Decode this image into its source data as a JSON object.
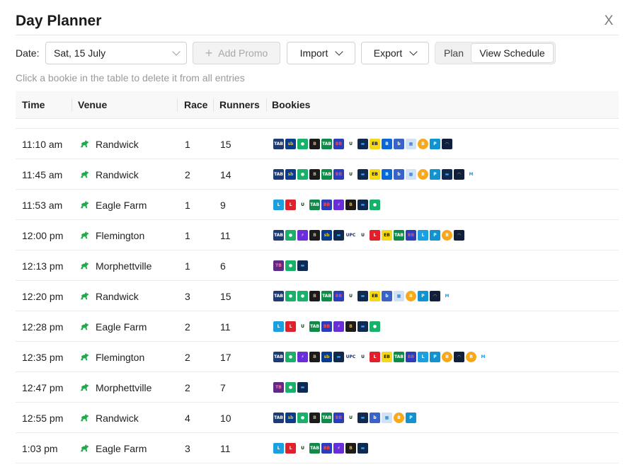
{
  "header": {
    "title": "Day Planner",
    "close_label": "X"
  },
  "toolbar": {
    "date_label": "Date:",
    "date_value": "Sat, 15 July",
    "add_promo_label": "Add Promo",
    "import_label": "Import",
    "export_label": "Export",
    "plan_label": "Plan",
    "view_schedule_label": "View Schedule"
  },
  "hint": "Click a bookie in the table to delete it from all entries",
  "table": {
    "columns": [
      "Time",
      "Venue",
      "Race",
      "Runners",
      "Bookies"
    ],
    "rows": [
      {
        "time": "11:10 am",
        "venue": "Randwick",
        "race": "1",
        "runners": "15",
        "bookies": [
          "tab",
          "sportsbet",
          "pointsbet-green",
          "betdeluxe",
          "tab-green",
          "betr-bb",
          "unibet",
          "bluebet",
          "elitebet",
          "betright-b",
          "bossbet-b",
          "bet-box",
          "bitcoin-b",
          "palmerbet-p",
          "wifi-bet"
        ]
      },
      {
        "time": "11:45 am",
        "venue": "Randwick",
        "race": "2",
        "runners": "14",
        "bookies": [
          "tab",
          "sportsbet",
          "pointsbet-green",
          "betdeluxe",
          "tab-green",
          "betr-bb",
          "unibet",
          "bluebet",
          "elitebet",
          "betright-b",
          "bossbet-b",
          "bet-box",
          "bitcoin-b",
          "palmerbet-p",
          "bluebet",
          "wifi-bet",
          "m-bet"
        ]
      },
      {
        "time": "11:53 am",
        "venue": "Eagle Farm",
        "race": "1",
        "runners": "9",
        "bookies": [
          "ladbrokes-blue",
          "ladbrokes-red",
          "unibet",
          "tab-green",
          "betr-bb",
          "betflux",
          "betdeluxe",
          "bluebet",
          "pointsbet-green"
        ]
      },
      {
        "time": "12:00 pm",
        "venue": "Flemington",
        "race": "1",
        "runners": "11",
        "bookies": [
          "tab",
          "pointsbet-green",
          "betflux",
          "betdeluxe",
          "sportsbet",
          "bluebet",
          "upc",
          "unibet",
          "ladbrokes-red",
          "elitebet",
          "tab-green",
          "betr-bb",
          "ladbrokes-blue",
          "palmerbet-p",
          "bitcoin-b",
          "wifi-bet"
        ]
      },
      {
        "time": "12:13 pm",
        "venue": "Morphettville",
        "race": "1",
        "runners": "6",
        "bookies": [
          "tab-purple",
          "pointsbet-green",
          "bluebet"
        ]
      },
      {
        "time": "12:20 pm",
        "venue": "Randwick",
        "race": "3",
        "runners": "15",
        "bookies": [
          "tab",
          "pointsbet-green",
          "pointsbet-green",
          "betdeluxe",
          "tab-green",
          "betr-bb",
          "unibet",
          "bluebet",
          "elitebet",
          "bossbet-b",
          "bet-box",
          "bitcoin-b",
          "palmerbet-p",
          "wifi-bet",
          "m-bet"
        ]
      },
      {
        "time": "12:28 pm",
        "venue": "Eagle Farm",
        "race": "2",
        "runners": "11",
        "bookies": [
          "ladbrokes-blue",
          "ladbrokes-red",
          "unibet",
          "tab-green",
          "betr-bb",
          "betflux",
          "betdeluxe",
          "bluebet",
          "pointsbet-green"
        ]
      },
      {
        "time": "12:35 pm",
        "venue": "Flemington",
        "race": "2",
        "runners": "17",
        "bookies": [
          "tab",
          "pointsbet-green",
          "betflux",
          "betdeluxe",
          "sportsbet",
          "bluebet",
          "upc",
          "unibet",
          "ladbrokes-red",
          "elitebet",
          "tab-green",
          "betr-bb",
          "ladbrokes-blue",
          "palmerbet-p",
          "bitcoin-b",
          "wifi-bet",
          "bitcoin-b",
          "m-bet"
        ]
      },
      {
        "time": "12:47 pm",
        "venue": "Morphettville",
        "race": "2",
        "runners": "7",
        "bookies": [
          "tab-purple",
          "pointsbet-green",
          "bluebet"
        ]
      },
      {
        "time": "12:55 pm",
        "venue": "Randwick",
        "race": "4",
        "runners": "10",
        "bookies": [
          "tab",
          "sportsbet",
          "pointsbet-green",
          "betdeluxe",
          "tab-green",
          "betr-bb",
          "unibet",
          "bluebet",
          "bossbet-b",
          "bet-box",
          "bitcoin-b",
          "palmerbet-p"
        ]
      },
      {
        "time": "1:03 pm",
        "venue": "Eagle Farm",
        "race": "3",
        "runners": "11",
        "bookies": [
          "ladbrokes-blue",
          "ladbrokes-red",
          "unibet",
          "tab-green",
          "betr-bb",
          "betflux",
          "betdeluxe",
          "bluebet"
        ]
      }
    ]
  },
  "bookie_styles": {
    "tab": {
      "bg": "#1f3b73",
      "text": "TAB"
    },
    "sportsbet": {
      "bg": "#0b3b8c",
      "text": "sb",
      "color": "#f7c600"
    },
    "pointsbet-green": {
      "bg": "#19b06a",
      "text": "●"
    },
    "betdeluxe": {
      "bg": "#1b1b1b",
      "text": "B",
      "color": "#d9b26a"
    },
    "tab-green": {
      "bg": "#0f8a48",
      "text": "TAB"
    },
    "betr-bb": {
      "bg": "#2a3dbb",
      "text": "BB",
      "color": "#ff4a4a"
    },
    "unibet": {
      "bg": "transparent",
      "text": "U",
      "color": "#0d2b12",
      "bare": true
    },
    "bluebet": {
      "bg": "#10294e",
      "text": "▬",
      "color": "#3aa3ff"
    },
    "elitebet": {
      "bg": "#f4d81a",
      "text": "EB",
      "color": "#111"
    },
    "betright-b": {
      "bg": "#0a67d8",
      "text": "B"
    },
    "bossbet-b": {
      "bg": "#3a63c9",
      "text": "b"
    },
    "bet-box": {
      "bg": "#cfe3f5",
      "text": "▦",
      "color": "#2870c4"
    },
    "bitcoin-b": {
      "bg": "#f7a81b",
      "text": "B",
      "round": true
    },
    "palmerbet-p": {
      "bg": "#1292cf",
      "text": "P"
    },
    "wifi-bet": {
      "bg": "#0f1f3d",
      "text": "◠",
      "color": "#f4c430"
    },
    "m-bet": {
      "bg": "transparent",
      "text": "M",
      "color": "#1aa3e8",
      "bare": true
    },
    "ladbrokes-blue": {
      "bg": "#1aa0e0",
      "text": "L"
    },
    "ladbrokes-red": {
      "bg": "#e0212b",
      "text": "L"
    },
    "betflux": {
      "bg": "#6a2ed8",
      "text": "⚡"
    },
    "upc": {
      "bg": "transparent",
      "text": "UPC",
      "color": "#1d2e6b",
      "bare": true
    },
    "tab-purple": {
      "bg": "#5b2b86",
      "text": "TB",
      "color": "#ff6fa8"
    }
  },
  "colors": {
    "horse_icon": "#1faa4b",
    "accent": "#1f1f1f"
  }
}
